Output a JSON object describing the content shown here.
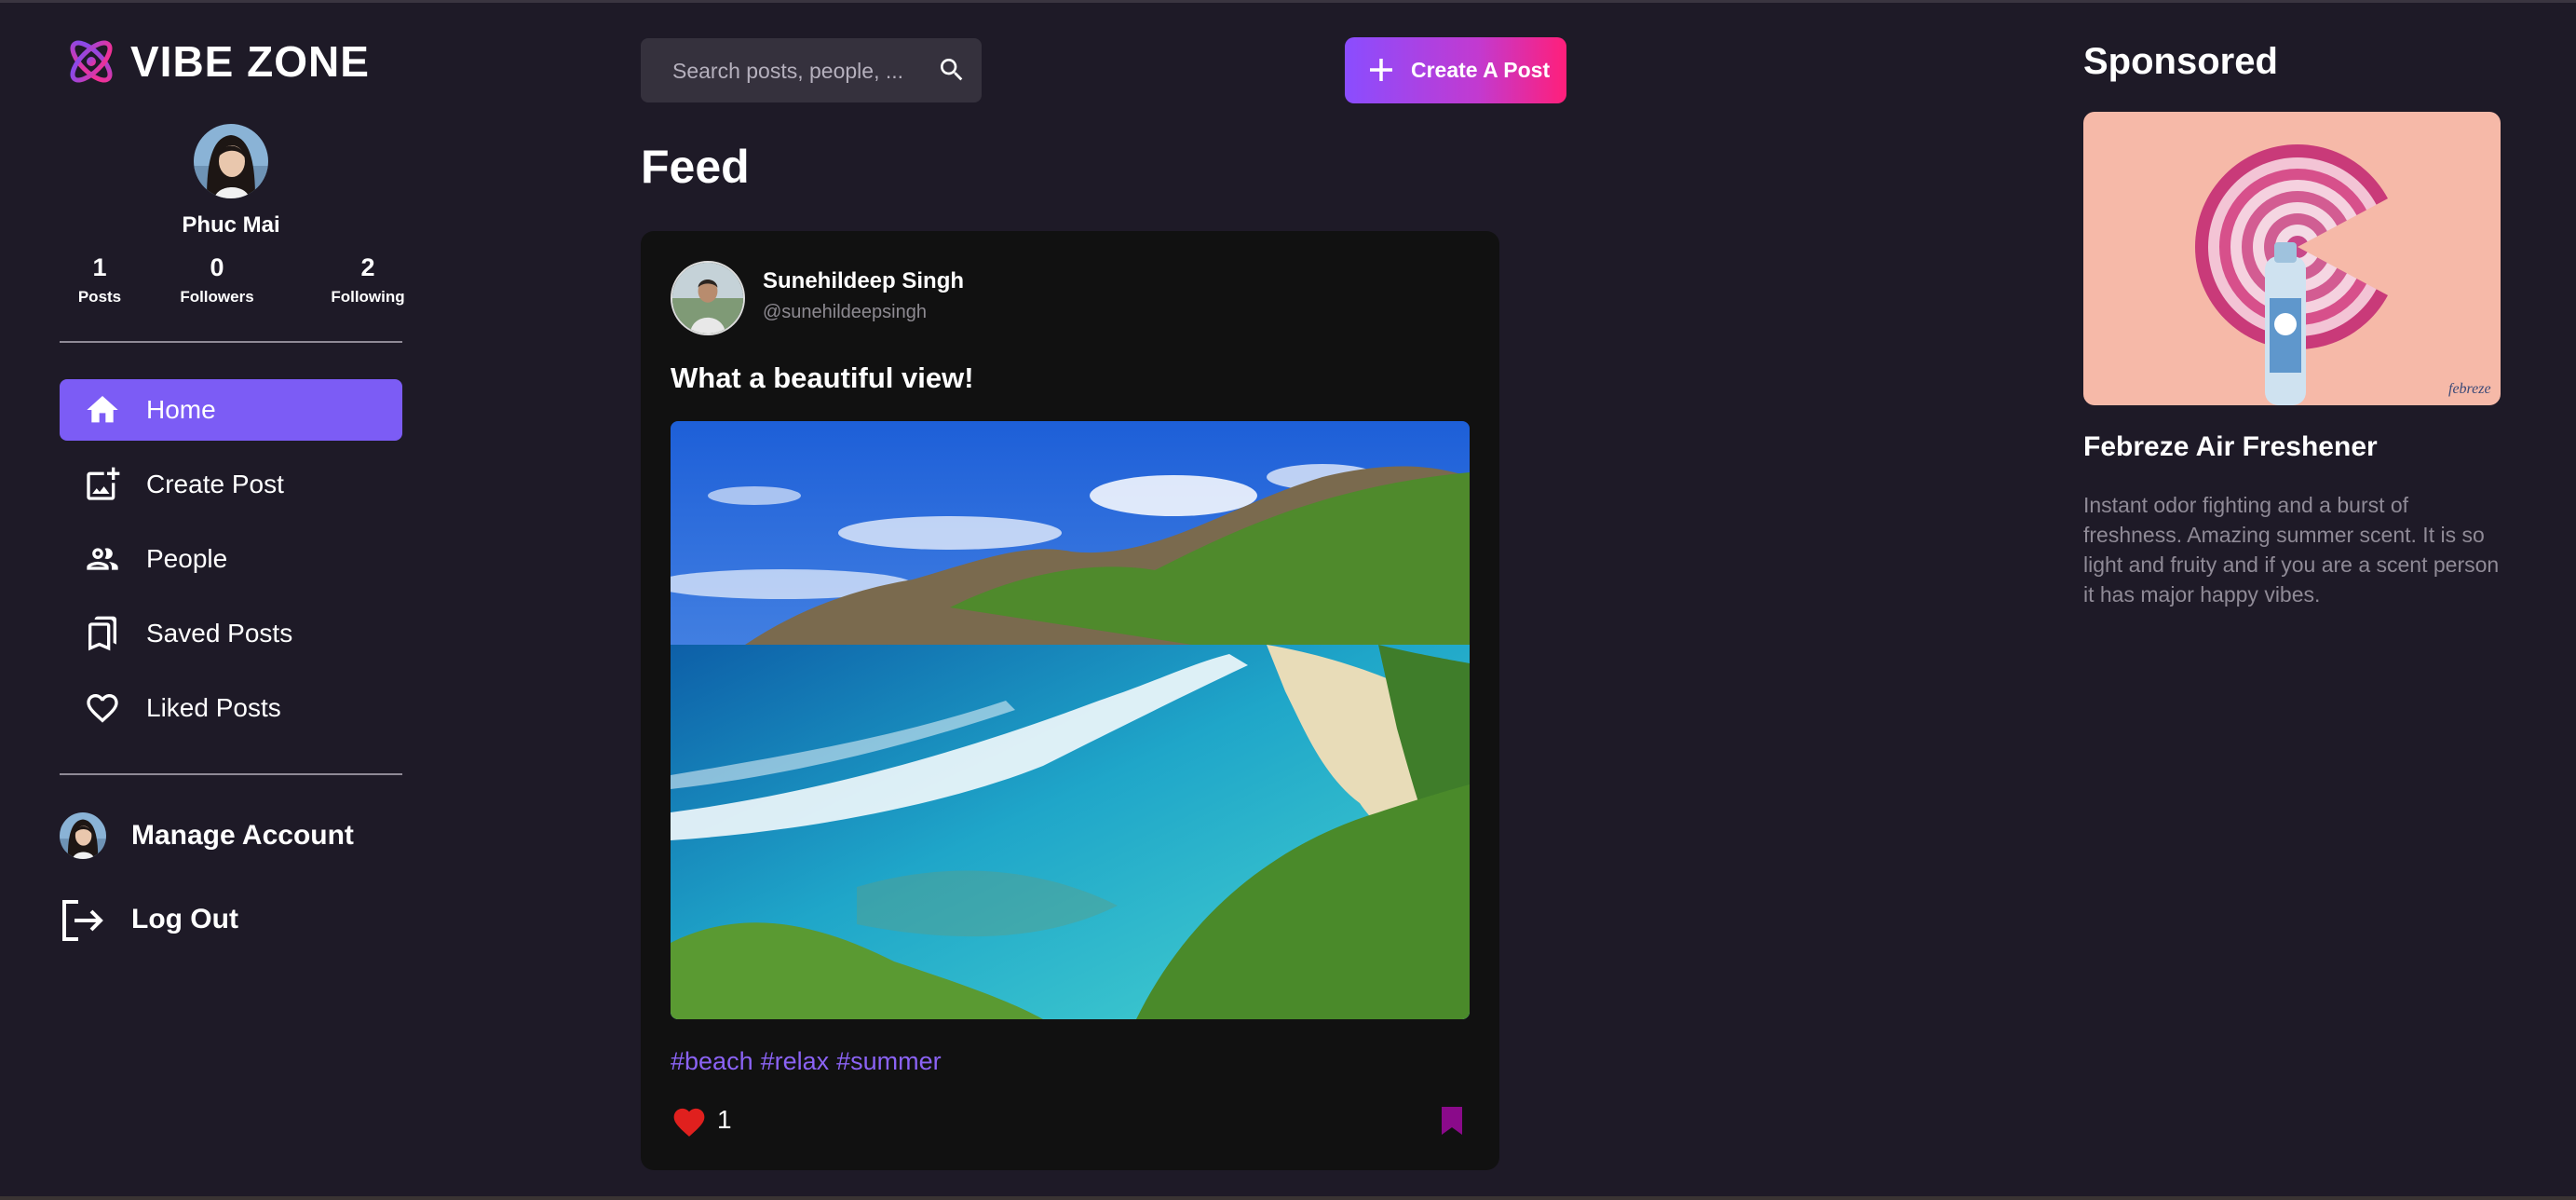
{
  "app": {
    "name": "VIBE ZONE"
  },
  "profile": {
    "name": "Phuc Mai",
    "stats": [
      {
        "value": "1",
        "label": "Posts"
      },
      {
        "value": "0",
        "label": "Followers"
      },
      {
        "value": "2",
        "label": "Following"
      }
    ]
  },
  "nav": {
    "items": [
      {
        "label": "Home",
        "icon": "home-icon",
        "active": true
      },
      {
        "label": "Create Post",
        "icon": "add-photo-icon",
        "active": false
      },
      {
        "label": "People",
        "icon": "people-icon",
        "active": false
      },
      {
        "label": "Saved Posts",
        "icon": "bookmarks-icon",
        "active": false
      },
      {
        "label": "Liked Posts",
        "icon": "heart-outline-icon",
        "active": false
      }
    ]
  },
  "account": {
    "manage_label": "Manage Account",
    "logout_label": "Log Out"
  },
  "search": {
    "placeholder": "Search posts, people, ..."
  },
  "create_button": {
    "label": "Create A Post"
  },
  "feed": {
    "title": "Feed",
    "posts": [
      {
        "author": "Sunehildeep Singh",
        "handle": "@sunehildeepsingh",
        "caption": "What a beautiful view!",
        "tags": [
          "#beach",
          "#relax",
          "#summer"
        ],
        "likes": "1",
        "liked": true,
        "saved": true
      }
    ]
  },
  "sponsored": {
    "title": "Sponsored",
    "name": "Febreze Air Freshener",
    "description": "Instant odor fighting and a burst of freshness. Amazing summer scent. It is so light and fruity and if you are a scent person it has major happy vibes.",
    "image_text": "febreze"
  },
  "colors": {
    "background": "#1e1a27",
    "accent": "#7c5cf5",
    "tag": "#8b63f5",
    "like": "#e0201e",
    "bookmark": "#8a0a8a",
    "card": "#111111"
  }
}
